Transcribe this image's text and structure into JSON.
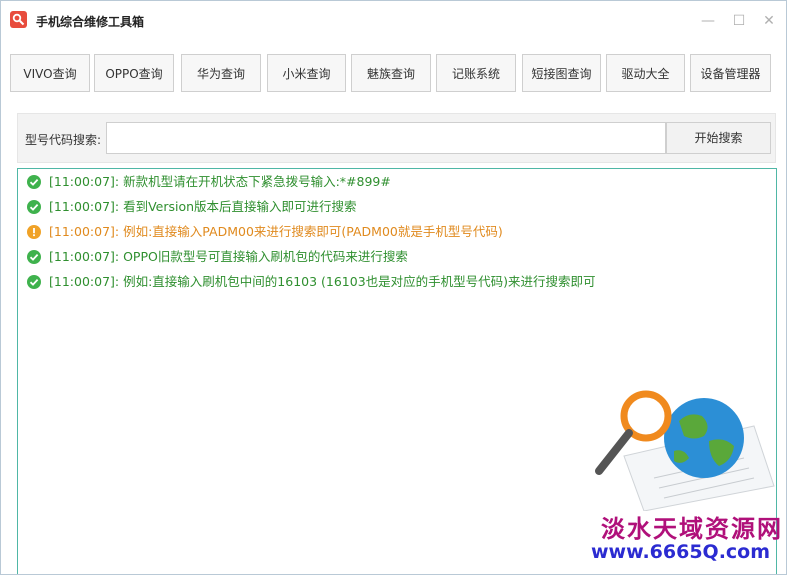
{
  "window": {
    "title": "手机综合维修工具箱",
    "minimize_symbol": "—",
    "maximize_symbol": "☐",
    "close_symbol": "✕"
  },
  "toolbar": {
    "buttons": [
      {
        "label": "VIVO查询"
      },
      {
        "label": "OPPO查询"
      },
      {
        "label": "华为查询"
      },
      {
        "label": "小米查询"
      },
      {
        "label": "魅族查询"
      },
      {
        "label": "记账系统"
      },
      {
        "label": "短接图查询"
      },
      {
        "label": "驱动大全"
      },
      {
        "label": "设备管理器"
      }
    ]
  },
  "search": {
    "label": "型号代码搜索:",
    "value": "",
    "placeholder": "",
    "button_label": "开始搜索"
  },
  "log": {
    "entries": [
      {
        "status": "ok",
        "icon": "check-circle-icon",
        "text": "[11:00:07]: 新款机型请在开机状态下紧急拨号输入:*#899#"
      },
      {
        "status": "ok",
        "icon": "check-circle-icon",
        "text": "[11:00:07]: 看到Version版本后直接输入即可进行搜索"
      },
      {
        "status": "warn",
        "icon": "warning-circle-icon",
        "text": "[11:00:07]: 例如:直接输入PADM00来进行搜索即可(PADM00就是手机型号代码)"
      },
      {
        "status": "ok",
        "icon": "check-circle-icon",
        "text": "[11:00:07]: OPPO旧款型号可直接输入刷机包的代码来进行搜索"
      },
      {
        "status": "ok",
        "icon": "check-circle-icon",
        "text": "[11:00:07]: 例如:直接输入刷机包中间的16103 (16103也是对应的手机型号代码)来进行搜索即可"
      }
    ]
  },
  "watermark": {
    "name": "淡水天域资源网",
    "url": "www.6665Q.com"
  },
  "colors": {
    "ok": "#2f8f2f",
    "warn": "#e08a1e",
    "log_border": "#4fb7a6",
    "app_icon": "#e84c3d"
  }
}
